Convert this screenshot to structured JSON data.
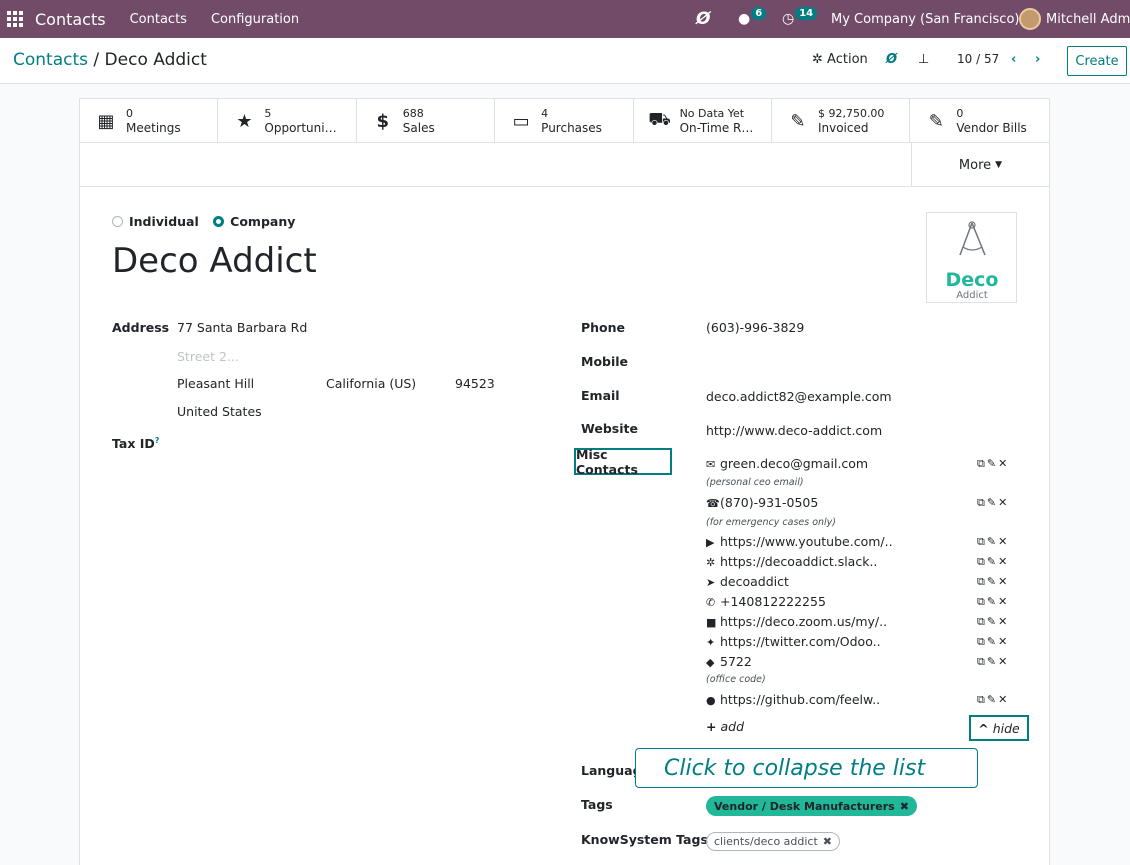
{
  "navbar": {
    "app_name": "Contacts",
    "menu_contacts": "Contacts",
    "menu_configuration": "Configuration",
    "messages_count": "6",
    "activities_count": "14",
    "company": "My Company (San Francisco)",
    "user": "Mitchell Admin"
  },
  "control": {
    "breadcrumb_root": "Contacts",
    "breadcrumb_sep": "/",
    "breadcrumb_current": "Deco Addict",
    "action_label": "Action",
    "pager": "10 / 57",
    "create_label": "Create"
  },
  "smart_buttons": [
    {
      "value": "0",
      "label": "Meetings",
      "icon": "calendar-icon"
    },
    {
      "value": "5",
      "label": "Opportuni…",
      "icon": "star-icon"
    },
    {
      "value": "688",
      "label": "Sales",
      "icon": "dollar-icon"
    },
    {
      "value": "4",
      "label": "Purchases",
      "icon": "credit-card-icon"
    },
    {
      "value": "No Data Yet",
      "label": "On-Time R…",
      "icon": "truck-icon"
    },
    {
      "value": "$ 92,750.00",
      "label": "Invoiced",
      "icon": "edit-icon"
    },
    {
      "value": "0",
      "label": "Vendor Bills",
      "icon": "edit-icon"
    }
  ],
  "more_label": "More",
  "company_type": {
    "individual": "Individual",
    "company": "Company",
    "selected": "Company"
  },
  "name": "Deco Addict",
  "logo": {
    "word": "Deco",
    "sub": "Addict"
  },
  "address": {
    "label": "Address",
    "street": "77 Santa Barbara Rd",
    "street2_placeholder": "Street 2...",
    "city": "Pleasant Hill",
    "state": "California (US)",
    "zip": "94523",
    "country": "United States"
  },
  "tax_id_label": "Tax ID",
  "tax_id_help": "?",
  "phone": {
    "label": "Phone",
    "value": "(603)-996-3829"
  },
  "mobile": {
    "label": "Mobile",
    "value": ""
  },
  "email": {
    "label": "Email",
    "value": "deco.addict82@example.com"
  },
  "website": {
    "label": "Website",
    "value": "http://www.deco-addict.com"
  },
  "misc_label": "Misc Contacts",
  "misc_contacts": [
    {
      "icon": "envelope-icon",
      "glyph": "✉",
      "value": "green.deco@gmail.com",
      "note": "(personal ceo email)"
    },
    {
      "icon": "phone-icon",
      "glyph": "☎",
      "value": "(870)-931-0505",
      "note": "(for emergency cases only)"
    },
    {
      "icon": "youtube-icon",
      "glyph": "▶",
      "value": "https://www.youtube.com/..",
      "note": ""
    },
    {
      "icon": "slack-icon",
      "glyph": "✲",
      "value": "https://decoaddict.slack..",
      "note": ""
    },
    {
      "icon": "telegram-icon",
      "glyph": "➤",
      "value": "decoaddict",
      "note": ""
    },
    {
      "icon": "whatsapp-icon",
      "glyph": "✆",
      "value": "+140812222255",
      "note": ""
    },
    {
      "icon": "video-icon",
      "glyph": "■",
      "value": "https://deco.zoom.us/my/..",
      "note": ""
    },
    {
      "icon": "twitter-icon",
      "glyph": "✦",
      "value": "https://twitter.com/Odoo..",
      "note": ""
    },
    {
      "icon": "tag-icon",
      "glyph": "◆",
      "value": "5722",
      "note": "(office code)"
    },
    {
      "icon": "github-icon",
      "glyph": "●",
      "value": "https://github.com/feelw..",
      "note": ""
    }
  ],
  "add_label": "add",
  "hide_label": "hide",
  "callout": "Click to collapse the list",
  "language_label": "Language",
  "tags_label": "Tags",
  "tag_green": "Vendor / Desk Manufacturers",
  "knowsystem_label": "KnowSystem Tags",
  "tag_knowsystem": "clients/deco addict",
  "colors": {
    "brand": "#714b67",
    "accent": "#017e84",
    "tag_green": "#21b799"
  }
}
